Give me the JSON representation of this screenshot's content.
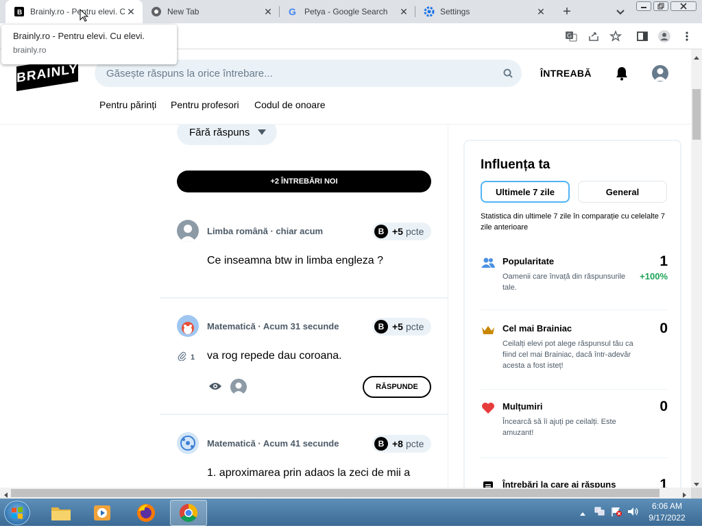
{
  "browser": {
    "tabs": [
      {
        "title": "Brainly.ro - Pentru elevi. C",
        "active": true,
        "icon": "brainly-favicon"
      },
      {
        "title": "New Tab",
        "active": false,
        "icon": "chrome-icon"
      },
      {
        "title": "Petya - Google Search",
        "active": false,
        "icon": "google-icon"
      },
      {
        "title": "Settings",
        "active": false,
        "icon": "settings-gear-icon"
      }
    ],
    "new_tab_symbol": "+",
    "tooltip": {
      "title": "Brainly.ro - Pentru elevi. Cu elevi.",
      "url": "brainly.ro"
    }
  },
  "header": {
    "logo": "BRAINLY",
    "search_placeholder": "Găsește răspuns la orice întrebare...",
    "ask_label": "ÎNTREABĂ",
    "nav": [
      "Pentru părinți",
      "Pentru profesori",
      "Codul de onoare"
    ]
  },
  "feed": {
    "filter_label": "Fără răspuns",
    "new_questions_label": "+2 ÎNTREBĂRI NOI",
    "questions": [
      {
        "subject": "Limba română",
        "time": "chiar acum",
        "points": "+5",
        "points_unit": "pcte",
        "text": "Ce inseamna btw in limba engleza ?"
      },
      {
        "subject": "Matematică",
        "time": "Acum 31 secunde",
        "points": "+5",
        "points_unit": "pcte",
        "text": "va rog repede dau coroana.",
        "attachments": "1",
        "answer_label": "RĂSPUNDE"
      },
      {
        "subject": "Matematică",
        "time": "Acum 41 secunde",
        "points": "+8",
        "points_unit": "pcte",
        "text": "1. aproximarea prin adaos la zeci de mii a"
      }
    ]
  },
  "panel": {
    "title": "Influența ta",
    "tab_active": "Ultimele 7 zile",
    "tab_other": "General",
    "description": "Statistica din ultimele 7 zile în comparație cu celelalte 7 zile anterioare",
    "stats": [
      {
        "name": "Popularitate",
        "value": "1",
        "desc": "Oamenii care învață din răspunsurile tale.",
        "change": "+100%",
        "icon": "people-icon",
        "color": "#4a90e2"
      },
      {
        "name": "Cel mai Brainiac",
        "value": "0",
        "desc": "Ceilalți elevi pot alege răspunsul tău ca fiind cel mai Brainiac, dacă într-adevăr acesta a fost isteț!",
        "icon": "crown-icon",
        "color": "#c98600"
      },
      {
        "name": "Mulțumiri",
        "value": "0",
        "desc": "Încearcă să îi ajuți pe ceilalți. Este amuzant!",
        "icon": "heart-icon",
        "color": "#e73c3c"
      },
      {
        "name": "Întrebări la care ai răspuns",
        "value": "1",
        "icon": "list-icon"
      }
    ]
  },
  "taskbar": {
    "time": "6:06 AM",
    "date": "9/17/2022"
  }
}
